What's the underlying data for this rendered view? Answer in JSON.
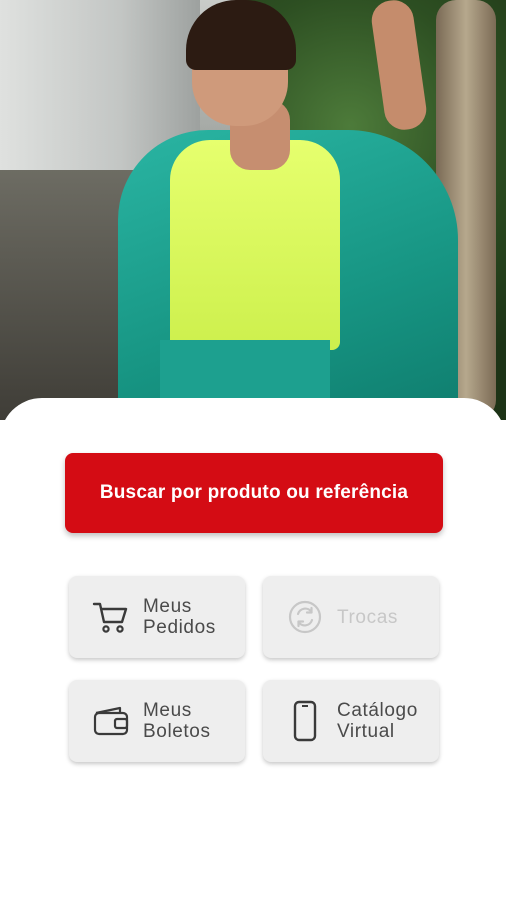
{
  "hero": {
    "image_alt": "Modelo vestindo cardigã verde"
  },
  "search": {
    "label": "Buscar por produto ou referência"
  },
  "tiles": {
    "pedidos": {
      "line1": "Meus",
      "line2": "Pedidos",
      "icon": "shopping-cart-icon",
      "enabled": true
    },
    "trocas": {
      "line1": "Trocas",
      "line2": "",
      "icon": "exchange-icon",
      "enabled": false
    },
    "boletos": {
      "line1": "Meus",
      "line2": "Boletos",
      "icon": "wallet-icon",
      "enabled": true
    },
    "catalogo": {
      "line1": "Catálogo",
      "line2": "Virtual",
      "icon": "smartphone-icon",
      "enabled": true
    }
  },
  "colors": {
    "accent": "#d40c14",
    "tile_bg": "#eeeeee",
    "tile_text": "#4a4a4a",
    "disabled_text": "#c7c7c7"
  }
}
